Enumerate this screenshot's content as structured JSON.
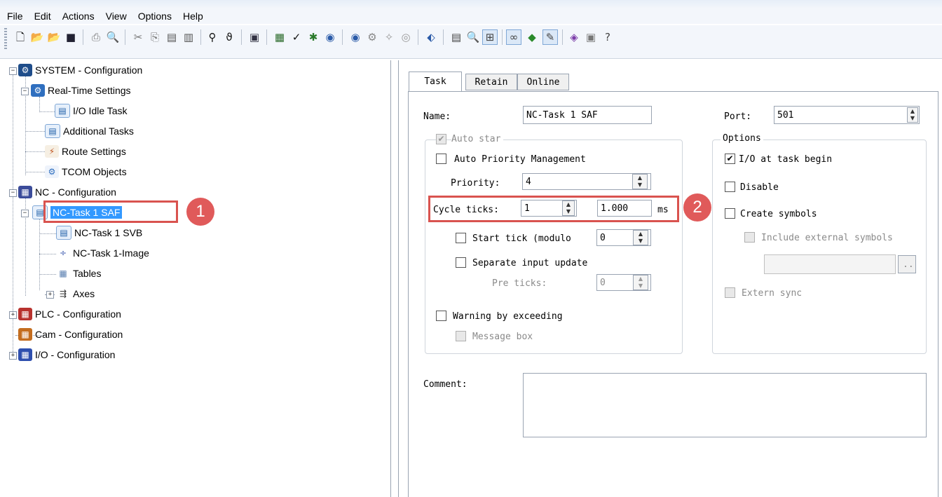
{
  "menu": [
    "File",
    "Edit",
    "Actions",
    "View",
    "Options",
    "Help"
  ],
  "toolbar_icons": [
    "new-file-icon",
    "open-icon",
    "open-project-icon",
    "save-icon",
    "print-icon",
    "print-preview-icon",
    "cut-icon",
    "copy-icon",
    "paste-icon",
    "paste-special-icon",
    "find-icon",
    "find-next-icon",
    "target-system-icon",
    "check-config-icon",
    "checkmark-icon",
    "activate-config-icon",
    "run-mode-icon",
    "config-mode-icon",
    "network-icon",
    "wand-icon",
    "record-icon",
    "settings-icon",
    "doc-icon",
    "zoom-icon",
    "show-online-icon",
    "show-bits-icon",
    "login-icon",
    "set-value-icon",
    "book-icon",
    "info-icon",
    "help-icon"
  ],
  "tree": {
    "items": [
      {
        "label": "SYSTEM - Configuration"
      },
      {
        "label": "Real-Time Settings"
      },
      {
        "label": "I/O Idle Task"
      },
      {
        "label": "Additional Tasks"
      },
      {
        "label": "Route Settings"
      },
      {
        "label": "TCOM Objects"
      },
      {
        "label": "NC - Configuration"
      },
      {
        "label": "NC-Task 1 SAF"
      },
      {
        "label": "NC-Task 1 SVB"
      },
      {
        "label": "NC-Task 1-Image"
      },
      {
        "label": "Tables"
      },
      {
        "label": "Axes"
      },
      {
        "label": "PLC - Configuration"
      },
      {
        "label": "Cam - Configuration"
      },
      {
        "label": "I/O - Configuration"
      }
    ],
    "expand_minus": "−",
    "expand_plus": "+"
  },
  "badges": {
    "one": "1",
    "two": "2"
  },
  "tabs": [
    "Task",
    "Retain",
    "Online"
  ],
  "form": {
    "name_label": "Name:",
    "name_value": "NC-Task 1 SAF",
    "port_label": "Port:",
    "port_value": "501",
    "auto_start": "Auto star",
    "auto_priority": "Auto Priority Management",
    "priority_label": "Priority:",
    "priority_value": "4",
    "cycle_label": "Cycle ticks:",
    "cycle_value": "1",
    "cycle_ms_value": "1.000",
    "ms_unit": "ms",
    "start_tick": "Start tick (modulo",
    "start_tick_value": "0",
    "separate_input": "Separate input update",
    "pre_ticks_label": "Pre ticks:",
    "pre_ticks_value": "0",
    "warning": "Warning by exceeding",
    "message_box": "Message box",
    "options_label": "Options",
    "io_task_begin": "I/O at task begin",
    "disable": "Disable",
    "create_symbols": "Create symbols",
    "include_external": "Include external symbols",
    "browse_label": "..",
    "extern_sync": "Extern sync",
    "comment_label": "Comment:",
    "check_mark": "✔"
  }
}
